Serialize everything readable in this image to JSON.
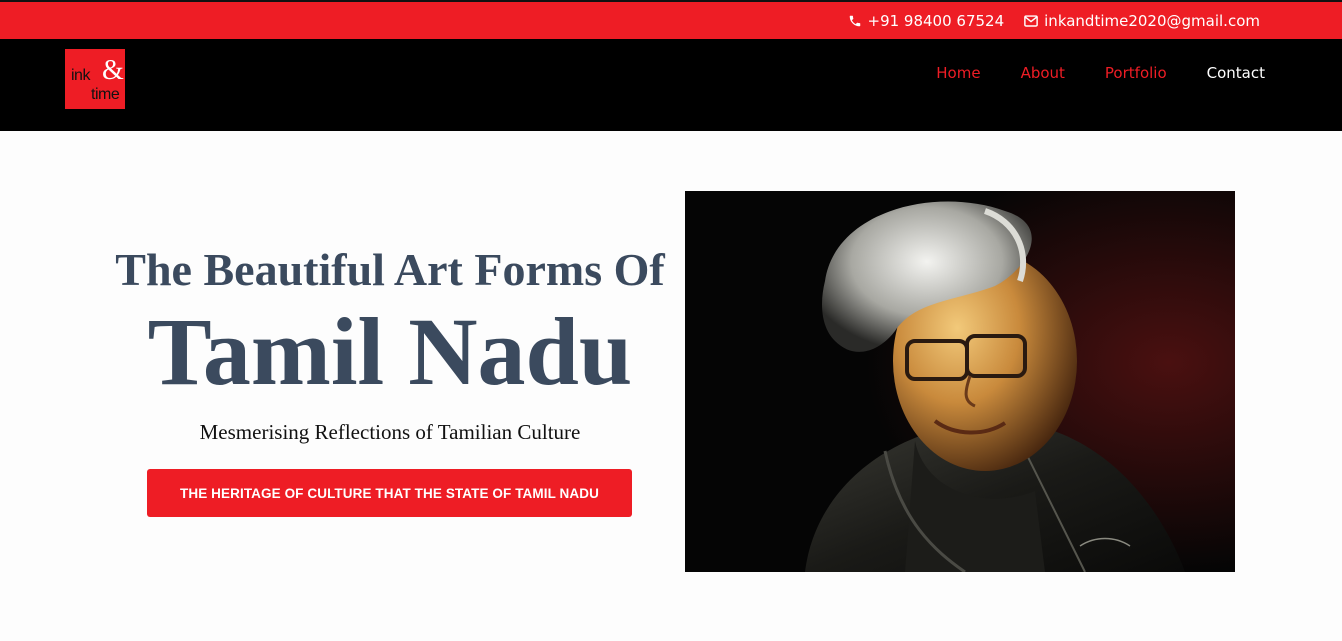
{
  "topbar": {
    "phone": "+91 98400 67524",
    "email": "inkandtime2020@gmail.com",
    "phone_icon": "phone-icon",
    "email_icon": "envelope-icon"
  },
  "logo": {
    "line1": "ink",
    "ampersand": "&",
    "line2": "time"
  },
  "nav": {
    "items": [
      {
        "label": "Home"
      },
      {
        "label": "About"
      },
      {
        "label": "Portfolio"
      },
      {
        "label": "Contact"
      }
    ],
    "active": "Contact"
  },
  "hero": {
    "title_line1": "The Beautiful Art Forms Of",
    "title_line2": "Tamil Nadu",
    "subtitle": "Mesmerising Reflections of Tamilian Culture",
    "cta_label": "THE HERITAGE OF CULTURE THAT THE STATE OF TAMIL NADU"
  },
  "colors": {
    "accent": "#ee1d25",
    "nav_bg": "#000000",
    "heading": "#3b4a5e"
  }
}
